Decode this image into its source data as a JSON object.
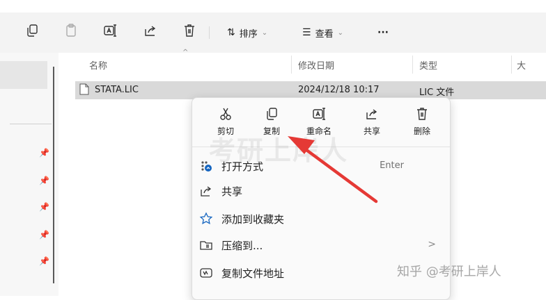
{
  "toolbar": {
    "sort_label": "排序",
    "view_label": "查看",
    "more_label": "···"
  },
  "columns": [
    "名称",
    "修改日期",
    "类型",
    "大"
  ],
  "file": {
    "name": "STATA.LIC",
    "modified": "2024/12/18 10:17",
    "type": "LIC 文件"
  },
  "context_menu": {
    "top_actions": [
      {
        "icon": "cut-icon",
        "label": "剪切"
      },
      {
        "icon": "copy-icon",
        "label": "复制"
      },
      {
        "icon": "rename-icon",
        "label": "重命名"
      },
      {
        "icon": "share-icon",
        "label": "共享"
      },
      {
        "icon": "delete-icon",
        "label": "删除"
      }
    ],
    "items": [
      {
        "icon": "open-with-icon",
        "label": "打开方式",
        "shortcut": "Enter"
      },
      {
        "icon": "share-icon",
        "label": "共享"
      },
      {
        "icon": "star-icon",
        "label": "添加到收藏夹"
      },
      {
        "icon": "compress-icon",
        "label": "压缩到...",
        "submenu": ">"
      },
      {
        "icon": "copy-path-icon",
        "label": "复制文件地址"
      }
    ]
  },
  "watermark_center": "考研上岸人",
  "watermark_corner": "知乎 @考研上岸人",
  "annotation_color": "#e53935"
}
